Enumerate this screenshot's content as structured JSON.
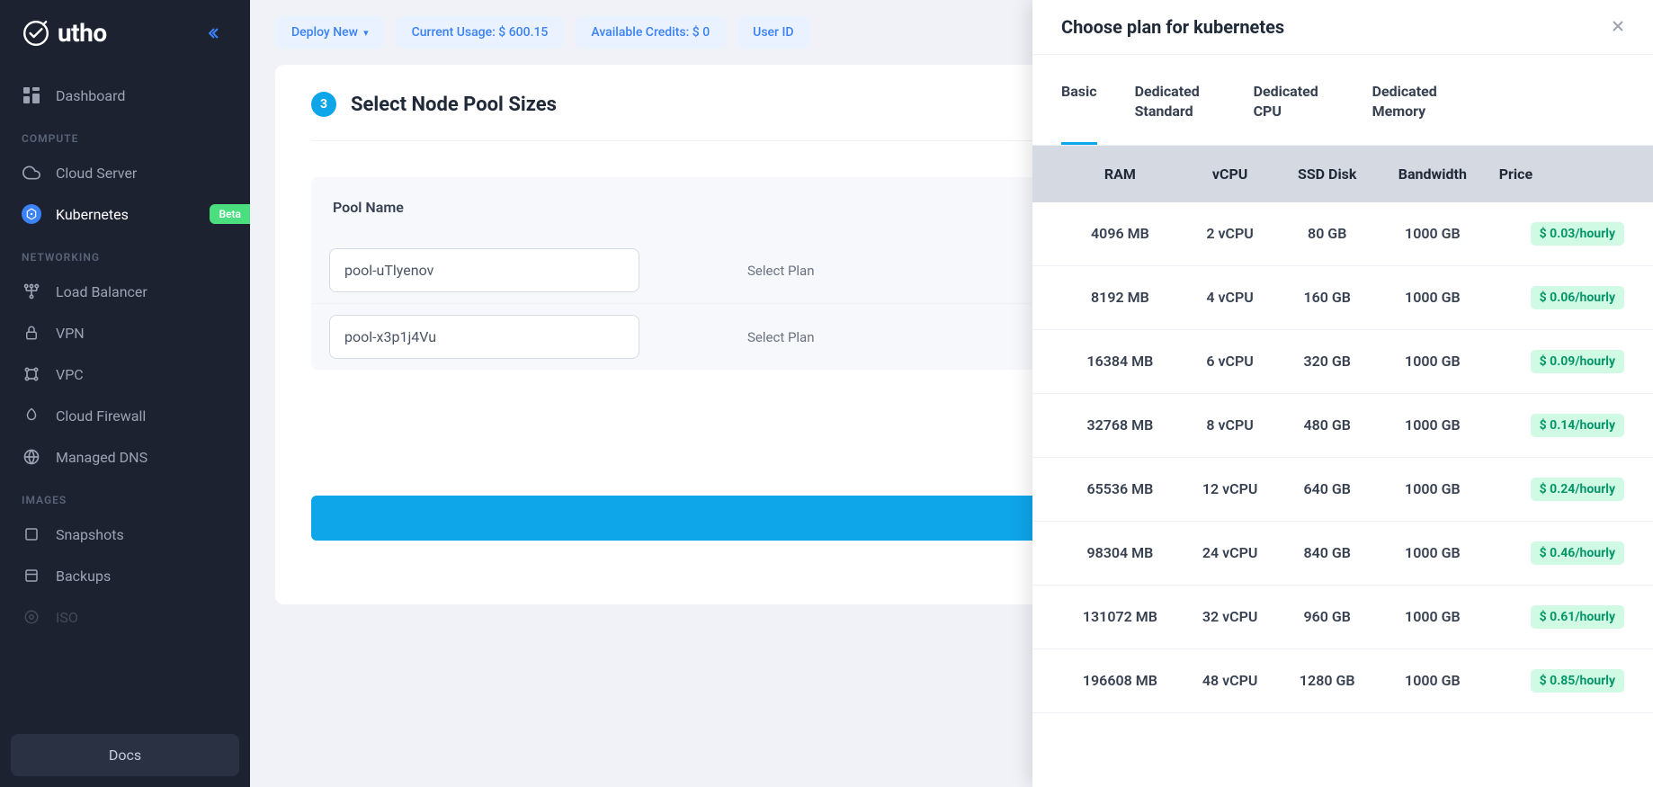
{
  "sidebar": {
    "logo_text": "utho",
    "items": [
      {
        "label": "Dashboard"
      },
      {
        "label": "Cloud Server"
      },
      {
        "label": "Kubernetes",
        "badge": "Beta"
      },
      {
        "label": "Load Balancer"
      },
      {
        "label": "VPN"
      },
      {
        "label": "VPC"
      },
      {
        "label": "Cloud Firewall"
      },
      {
        "label": "Managed DNS"
      },
      {
        "label": "Snapshots"
      },
      {
        "label": "Backups"
      },
      {
        "label": "ISO"
      }
    ],
    "sections": {
      "compute": "COMPUTE",
      "networking": "NETWORKING",
      "images": "IMAGES"
    },
    "docs": "Docs"
  },
  "top": {
    "deploy": "Deploy New",
    "usage": "Current Usage: $ 600.15",
    "credits": "Available Credits: $ 0",
    "user": "User ID"
  },
  "step": {
    "num": "3",
    "title": "Select Node Pool Sizes",
    "pool_header": "Pool Name",
    "pool1": "pool-uTlyenov",
    "pool2": "pool-x3p1j4Vu",
    "select_plan": "Select Plan"
  },
  "drawer": {
    "title": "Choose plan for kubernetes",
    "tabs": [
      "Basic",
      "Dedicated Standard",
      "Dedicated CPU",
      "Dedicated Memory"
    ],
    "cols": [
      "RAM",
      "vCPU",
      "SSD Disk",
      "Bandwidth",
      "Price"
    ],
    "rows": [
      {
        "ram": "4096 MB",
        "vcpu": "2 vCPU",
        "disk": "80 GB",
        "bw": "1000 GB",
        "price": "$ 0.03/hourly"
      },
      {
        "ram": "8192 MB",
        "vcpu": "4 vCPU",
        "disk": "160 GB",
        "bw": "1000 GB",
        "price": "$ 0.06/hourly"
      },
      {
        "ram": "16384 MB",
        "vcpu": "6 vCPU",
        "disk": "320 GB",
        "bw": "1000 GB",
        "price": "$ 0.09/hourly"
      },
      {
        "ram": "32768 MB",
        "vcpu": "8 vCPU",
        "disk": "480 GB",
        "bw": "1000 GB",
        "price": "$ 0.14/hourly"
      },
      {
        "ram": "65536 MB",
        "vcpu": "12 vCPU",
        "disk": "640 GB",
        "bw": "1000 GB",
        "price": "$ 0.24/hourly"
      },
      {
        "ram": "98304 MB",
        "vcpu": "24 vCPU",
        "disk": "840 GB",
        "bw": "1000 GB",
        "price": "$ 0.46/hourly"
      },
      {
        "ram": "131072 MB",
        "vcpu": "32 vCPU",
        "disk": "960 GB",
        "bw": "1000 GB",
        "price": "$ 0.61/hourly"
      },
      {
        "ram": "196608 MB",
        "vcpu": "48 vCPU",
        "disk": "1280 GB",
        "bw": "1000 GB",
        "price": "$ 0.85/hourly"
      }
    ]
  }
}
